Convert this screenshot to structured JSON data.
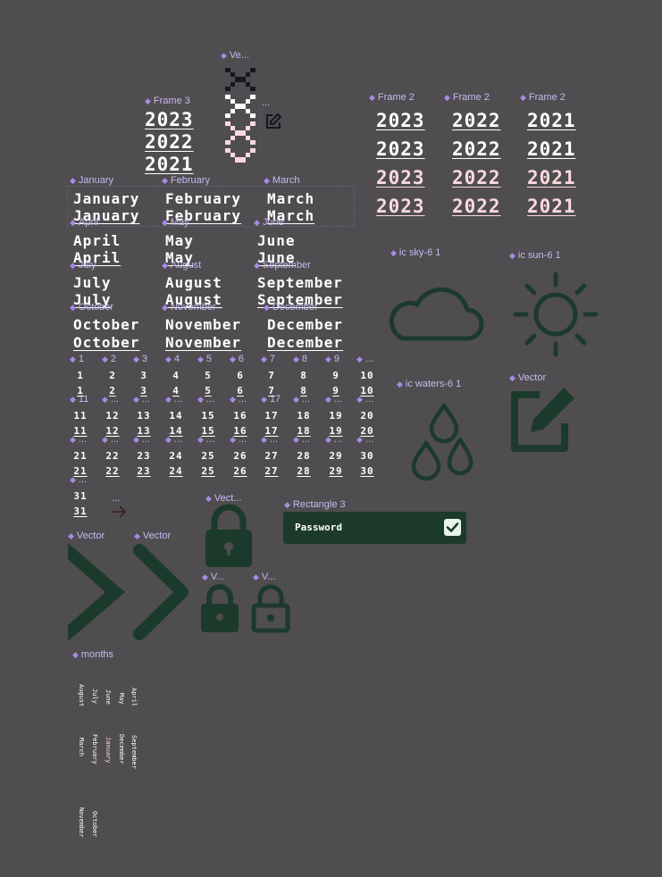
{
  "colors": {
    "background": "#4f4d4f",
    "icon": "#1c3a2c",
    "label": "#c7b9f2",
    "label_marker": "#a68ce8",
    "pink": "#fbd9dd",
    "white": "#ffffff"
  },
  "labels": {
    "vector_top": "Ve...",
    "ellipsis": "...",
    "frame3": "Frame 3",
    "frame2a": "Frame 2",
    "frame2b": "Frame 2",
    "frame2c": "Frame 2",
    "january": "January",
    "february": "February",
    "march": "March",
    "april": "April",
    "may": "May",
    "june": "June",
    "july": "July",
    "august": "August",
    "september": "September",
    "october": "October",
    "november": "November",
    "december": "December",
    "ic_sky": "ic sky-6 1",
    "ic_sun": "ic sun-6 1",
    "ic_waters": "ic waters-6 1",
    "vector_edit": "Vector",
    "vector_lock": "Vect...",
    "rect3": "Rectangle 3",
    "vector_chev1": "Vector",
    "vector_chev2": "Vector",
    "v_lock2": "V...",
    "v_lock3": "V...",
    "months": "months",
    "day_more": "...",
    "day_first": "1",
    "day_second": "2",
    "day_third": "3",
    "day_fourth": "4",
    "day_fifth": "5",
    "day_sixth": "6",
    "day_seventh": "7",
    "day_eighth": "8",
    "day_ninth": "9",
    "day_eleventh": "11",
    "day_seventeenth": "17"
  },
  "frame3_years": [
    "2023",
    "2022",
    "2021"
  ],
  "frame2_grid": [
    [
      "2023",
      "2022",
      "2021"
    ],
    [
      "2023",
      "2022",
      "2021"
    ],
    [
      "2023",
      "2022",
      "2021"
    ],
    [
      "2023",
      "2022",
      "2021"
    ]
  ],
  "months_grid": [
    [
      "January",
      "February",
      "March"
    ],
    [
      "April",
      "May",
      "June"
    ],
    [
      "July",
      "August",
      "September"
    ],
    [
      "October",
      "November",
      "December"
    ]
  ],
  "days": [
    "1",
    "2",
    "3",
    "4",
    "5",
    "6",
    "7",
    "8",
    "9",
    "10",
    "11",
    "12",
    "13",
    "14",
    "15",
    "16",
    "17",
    "18",
    "19",
    "20",
    "21",
    "22",
    "23",
    "24",
    "25",
    "26",
    "27",
    "28",
    "29",
    "30",
    "31"
  ],
  "password": {
    "label": "Password",
    "checked": true
  },
  "months_vertical": {
    "col1": [
      "August",
      "March",
      "November"
    ],
    "col2": [
      "July",
      "February",
      "October"
    ],
    "col3": [
      "June",
      "January"
    ],
    "col4": [
      "May",
      "December"
    ],
    "col5": [
      "April",
      "September"
    ]
  }
}
